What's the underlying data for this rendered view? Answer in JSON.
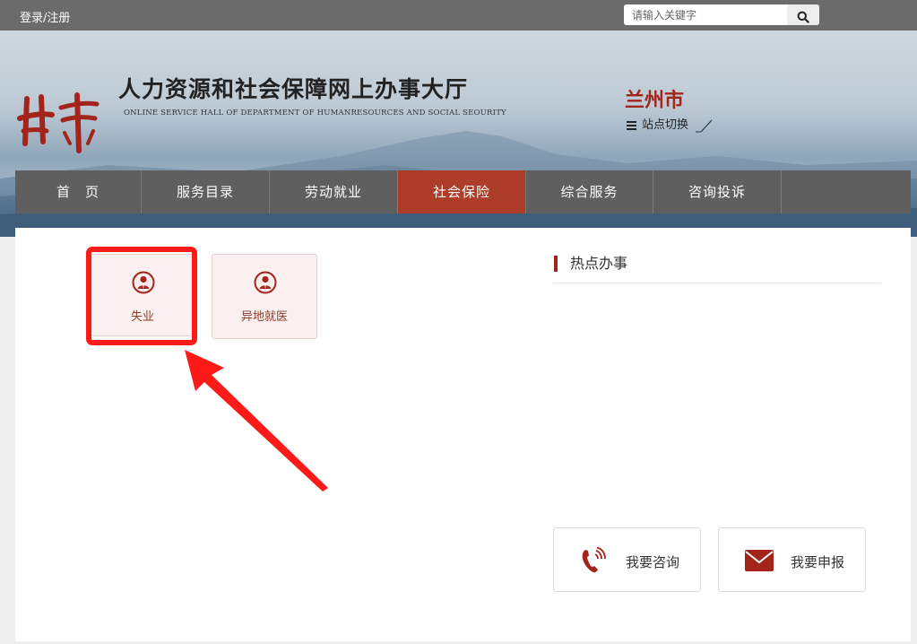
{
  "header": {
    "login_register": "登录/注册",
    "search_placeholder": "请输入关键字",
    "site_title": "人力资源和社会保障网上办事大厅",
    "site_subtitle": "ONLINE SERVICE HALL OF DEPARTMENT OF HUMANRESOURCES AND SOCIAL SEOURITY",
    "province_logo_text": "甘肃",
    "city": "兰州市",
    "site_switch": "站点切换"
  },
  "nav": {
    "items": [
      "首　页",
      "服务目录",
      "劳动就业",
      "社会保险",
      "综合服务",
      "咨询投诉"
    ],
    "active_index": 3
  },
  "services": [
    {
      "label": "失业",
      "icon": "person-circle-icon",
      "highlighted": true
    },
    {
      "label": "异地就医",
      "icon": "person-circle-icon",
      "highlighted": false
    }
  ],
  "hot": {
    "title": "热点办事"
  },
  "actions": [
    {
      "label": "我要咨询",
      "icon": "phone-icon"
    },
    {
      "label": "我要申报",
      "icon": "envelope-icon"
    }
  ],
  "colors": {
    "accent": "#a3241a",
    "nav_bg": "#5f5f5f",
    "nav_active": "#ad3d28",
    "highlight": "#ff1a1a",
    "card_bg": "#fbf0ef"
  }
}
